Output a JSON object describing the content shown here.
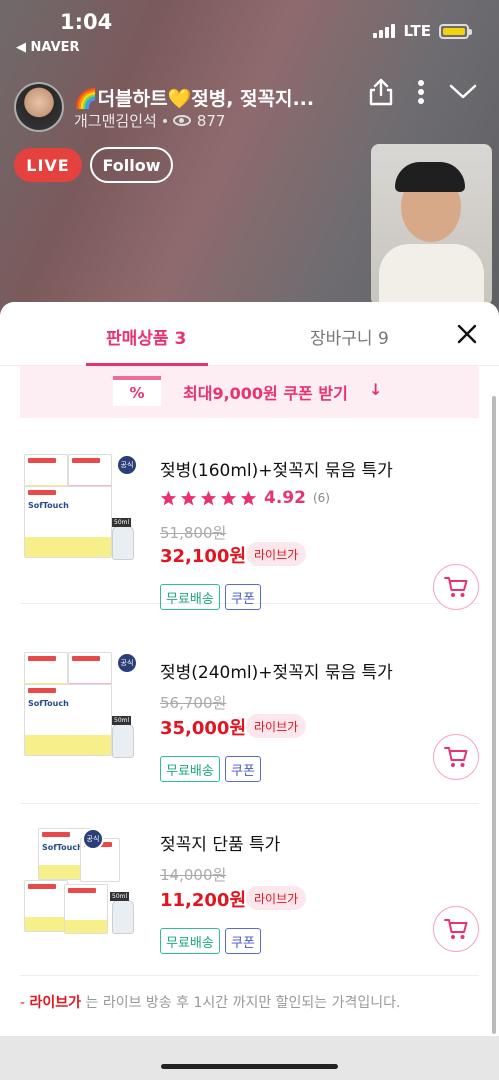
{
  "status_bar": {
    "time": "1:04",
    "back_app": "◀ NAVER",
    "network": "LTE",
    "battery_color": "#f5d20b"
  },
  "broadcast": {
    "title": "🌈더블하트💛젖병, 젖꼭지...",
    "channel": "개그맨김인석",
    "viewers": "877",
    "live_label": "LIVE",
    "follow_label": "Follow"
  },
  "sheet": {
    "tabs": [
      {
        "label": "판매상품 3",
        "active": true
      },
      {
        "label": "장바구니 9",
        "active": false
      }
    ],
    "coupon": {
      "icon_text": "%",
      "text": "최대9,000원 쿠폰 받기",
      "arrow": "↓"
    },
    "products": [
      {
        "name": "젖병(160ml)+젖꼭지 묶음 특가",
        "rating": "4.92",
        "rating_count": "(6)",
        "original_price": "51,800원",
        "price": "32,100원",
        "live_tag": "라이브가",
        "tag_shipping": "무료배송",
        "tag_coupon": "쿠폰"
      },
      {
        "name": "젖병(240ml)+젖꼭지 묶음 특가",
        "original_price": "56,700원",
        "price": "35,000원",
        "live_tag": "라이브가",
        "tag_shipping": "무료배송",
        "tag_coupon": "쿠폰"
      },
      {
        "name": "젖꼭지 단품 특가",
        "original_price": "14,000원",
        "price": "11,200원",
        "live_tag": "라이브가",
        "tag_shipping": "무료배송",
        "tag_coupon": "쿠폰"
      }
    ],
    "notice": {
      "prefix": "- ",
      "highlight": "라이브가",
      "text": " 는 라이브 방송 후 1시간 까지만 할인되는 가격입니다."
    }
  },
  "colors": {
    "accent": "#e8336f",
    "price_red": "#e3141f",
    "shipping_green": "#1da77a",
    "coupon_blue": "#4a5bc4"
  },
  "icons": {
    "share": "share-icon",
    "more": "more-vertical-icon",
    "collapse": "chevron-down-icon",
    "close": "close-icon",
    "cart": "cart-icon",
    "star": "star-icon",
    "eye": "eye-icon"
  }
}
